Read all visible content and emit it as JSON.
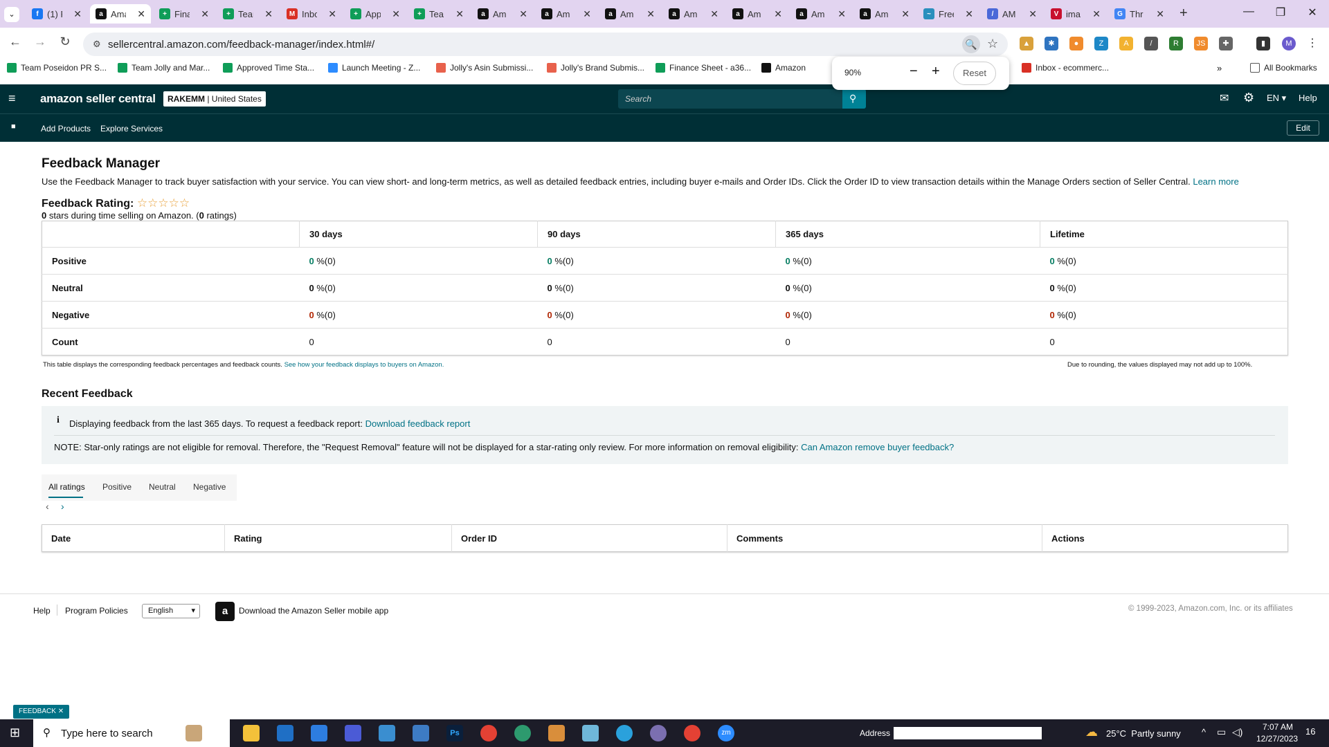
{
  "browser": {
    "tabs": [
      {
        "title": "(1) F",
        "icon": "facebook-icon",
        "color": "#1877f2",
        "glyph": "f"
      },
      {
        "title": "Ama",
        "icon": "amazon-icon",
        "color": "#111",
        "glyph": "a",
        "active": true
      },
      {
        "title": "Fina",
        "icon": "sheets-icon",
        "color": "#0f9d58",
        "glyph": "+"
      },
      {
        "title": "Tear",
        "icon": "sheets-icon",
        "color": "#0f9d58",
        "glyph": "+"
      },
      {
        "title": "Inbo",
        "icon": "gmail-icon",
        "color": "#d93025",
        "glyph": "M"
      },
      {
        "title": "App",
        "icon": "sheets-icon",
        "color": "#0f9d58",
        "glyph": "+"
      },
      {
        "title": "Tea",
        "icon": "sheets-icon",
        "color": "#0f9d58",
        "glyph": "+"
      },
      {
        "title": "Am",
        "icon": "amazon-icon",
        "color": "#111",
        "glyph": "a"
      },
      {
        "title": "Am",
        "icon": "amazon-icon",
        "color": "#111",
        "glyph": "a"
      },
      {
        "title": "Am",
        "icon": "amazon-icon",
        "color": "#111",
        "glyph": "a"
      },
      {
        "title": "Am",
        "icon": "amazon-icon",
        "color": "#111",
        "glyph": "a"
      },
      {
        "title": "Am",
        "icon": "amazon-icon",
        "color": "#111",
        "glyph": "a"
      },
      {
        "title": "Am",
        "icon": "amazon-icon",
        "color": "#111",
        "glyph": "a"
      },
      {
        "title": "Am",
        "icon": "amazon-icon",
        "color": "#111",
        "glyph": "a"
      },
      {
        "title": "Free",
        "icon": "cloud-icon",
        "color": "#2a8fbd",
        "glyph": "~"
      },
      {
        "title": "AM",
        "icon": "tool-icon",
        "color": "#4a68d8",
        "glyph": "/"
      },
      {
        "title": "ima",
        "icon": "pinterest-icon",
        "color": "#c8102e",
        "glyph": "V"
      },
      {
        "title": "Thr",
        "icon": "google-icon",
        "color": "#4285f4",
        "glyph": "G"
      }
    ],
    "url": "sellercentral.amazon.com/feedback-manager/index.html#/",
    "bookmarks": [
      {
        "label": "Team Poseidon PR S...",
        "color": "#0f9d58"
      },
      {
        "label": "Team Jolly and Mar...",
        "color": "#0f9d58"
      },
      {
        "label": "Approved Time Sta...",
        "color": "#0f9d58"
      },
      {
        "label": "Launch Meeting - Z...",
        "color": "#2d8cff"
      },
      {
        "label": "Jolly's Asin Submissi...",
        "color": "#e8614c"
      },
      {
        "label": "Jolly's Brand Submis...",
        "color": "#e8614c"
      },
      {
        "label": "Finance Sheet - a36...",
        "color": "#0f9d58"
      },
      {
        "label": "Amazon",
        "color": "#111"
      },
      {
        "label": "Inbox - ecommerc...",
        "color": "#d93025"
      }
    ],
    "all_bookmarks": "All Bookmarks",
    "zoom": {
      "level": "90%",
      "reset": "Reset"
    }
  },
  "header": {
    "logo": "amazon seller central",
    "account_name": "RAKEMM",
    "account_region": "United States",
    "search_placeholder": "Search",
    "lang": "EN",
    "help": "Help",
    "nav": [
      "Add Products",
      "Explore Services"
    ],
    "edit": "Edit"
  },
  "feedback": {
    "title": "Feedback Manager",
    "description": "Use the Feedback Manager to track buyer satisfaction with your service. You can view short- and long-term metrics, as well as detailed feedback entries, including buyer e-mails and Order IDs. Click the Order ID to view transaction details within the Manage Orders section of Seller Central.",
    "learn_more": "Learn more",
    "rating_label": "Feedback Rating:",
    "rating_stars": 0,
    "rating_stars_max": 5,
    "summary_stars": "0",
    "summary_mid": " stars during time selling on Amazon. (",
    "summary_count": "0",
    "summary_end": " ratings)",
    "columns": [
      "30 days",
      "90 days",
      "365 days",
      "Lifetime"
    ],
    "rows": [
      {
        "label": "Positive",
        "values": [
          "0",
          "0",
          "0",
          "0"
        ],
        "suffix": " %(0)",
        "style": "g"
      },
      {
        "label": "Neutral",
        "values": [
          "0",
          "0",
          "0",
          "0"
        ],
        "suffix": " %(0)",
        "style": "b"
      },
      {
        "label": "Negative",
        "values": [
          "0",
          "0",
          "0",
          "0"
        ],
        "suffix": " %(0)",
        "style": "r"
      }
    ],
    "count_label": "Count",
    "counts": [
      "0",
      "0",
      "0",
      "0"
    ],
    "table_note": "This table displays the corresponding feedback percentages and feedback counts.",
    "table_note_link": "See how your feedback displays to buyers on Amazon.",
    "rounding_note": "Due to rounding, the values displayed may not add up to 100%."
  },
  "recent": {
    "title": "Recent Feedback",
    "info_text": "Displaying feedback from the last 365 days. To request a feedback report:",
    "info_link": "Download feedback report",
    "note_text": "NOTE: Star-only ratings are not eligible for removal. Therefore, the \"Request Removal\" feature will not be displayed for a star-rating only review. For more information on removal eligibility:",
    "note_link": "Can Amazon remove buyer feedback?",
    "tabs": [
      "All ratings",
      "Positive",
      "Neutral",
      "Negative"
    ],
    "columns": [
      "Date",
      "Rating",
      "Order ID",
      "Comments",
      "Actions"
    ]
  },
  "footer": {
    "help": "Help",
    "policies": "Program Policies",
    "language": "English",
    "app": "Download the Amazon Seller mobile app",
    "copyright": "© 1999-2023, Amazon.com, Inc. or its affiliates",
    "feedback_btn": "FEEDBACK"
  },
  "taskbar": {
    "search_placeholder": "Type here to search",
    "address_label": "Address",
    "weather": "25°C  Partly sunny",
    "time": "7:07 AM",
    "date": "12/27/2023",
    "notifications": "16"
  },
  "colors": {
    "amazon_header": "#002f36",
    "link": "#007185",
    "positive": "#067d62",
    "negative": "#b12704"
  }
}
